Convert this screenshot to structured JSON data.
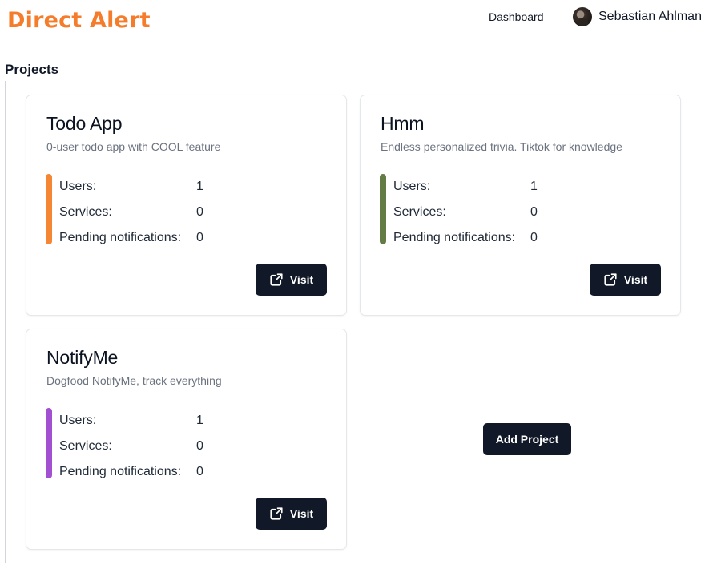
{
  "header": {
    "brand": "Direct Alert",
    "nav_dashboard": "Dashboard",
    "user_name": "Sebastian Ahlman"
  },
  "main": {
    "section_title": "Projects",
    "add_project_label": "Add Project",
    "projects": [
      {
        "title": "Todo App",
        "description": "0-user todo app with COOL feature",
        "accent_color": "#f58634",
        "stats": [
          {
            "label": "Users:",
            "value": "1"
          },
          {
            "label": "Services:",
            "value": "0"
          },
          {
            "label": "Pending notifications:",
            "value": "0"
          }
        ],
        "visit_label": "Visit"
      },
      {
        "title": "Hmm",
        "description": "Endless personalized trivia. Tiktok for knowledge",
        "accent_color": "#637b45",
        "stats": [
          {
            "label": "Users:",
            "value": "1"
          },
          {
            "label": "Services:",
            "value": "0"
          },
          {
            "label": "Pending notifications:",
            "value": "0"
          }
        ],
        "visit_label": "Visit"
      },
      {
        "title": "NotifyMe",
        "description": "Dogfood NotifyMe, track everything",
        "accent_color": "#a24fd1",
        "stats": [
          {
            "label": "Users:",
            "value": "1"
          },
          {
            "label": "Services:",
            "value": "0"
          },
          {
            "label": "Pending notifications:",
            "value": "0"
          }
        ],
        "visit_label": "Visit"
      }
    ]
  },
  "icons": {
    "visit": "external-link-icon",
    "avatar": "user-avatar"
  }
}
